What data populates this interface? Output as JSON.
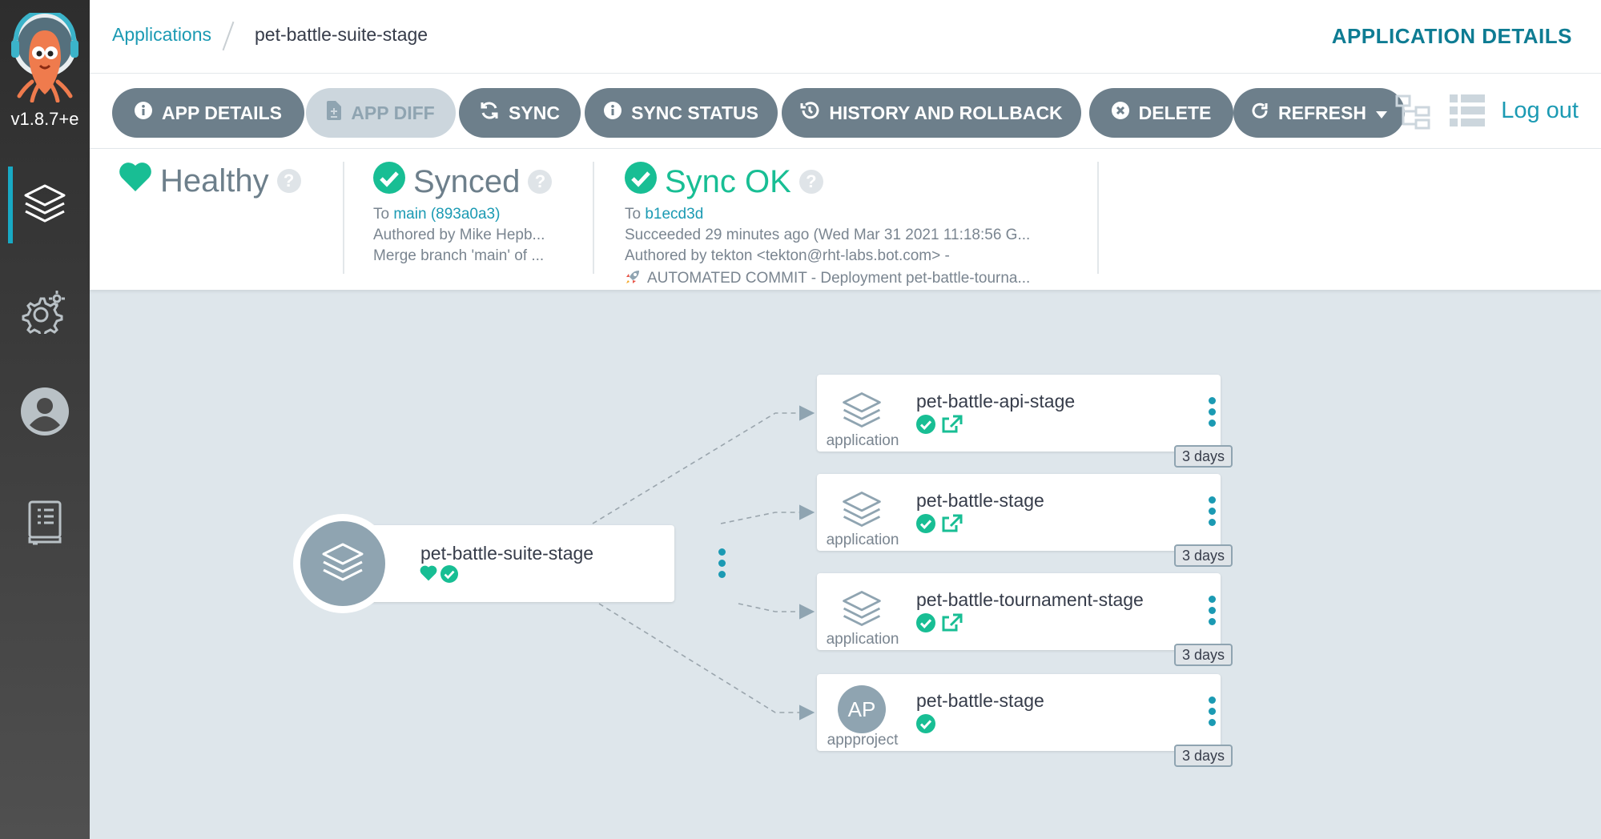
{
  "sidebar": {
    "version": "v1.8.7+e",
    "nav": [
      {
        "name": "applications",
        "icon": "layers-icon"
      },
      {
        "name": "settings",
        "icon": "gear-icon"
      },
      {
        "name": "user-info",
        "icon": "user-icon"
      },
      {
        "name": "docs",
        "icon": "book-icon"
      }
    ]
  },
  "breadcrumb": {
    "root": "Applications",
    "current": "pet-battle-suite-stage"
  },
  "page_heading": "APPLICATION DETAILS",
  "toolbar": {
    "app_details": "APP DETAILS",
    "app_diff": "APP DIFF",
    "sync": "SYNC",
    "sync_status": "SYNC STATUS",
    "history": "HISTORY AND ROLLBACK",
    "delete": "DELETE",
    "refresh": "REFRESH",
    "logout": "Log out"
  },
  "status": {
    "health": {
      "label": "Healthy",
      "color": "#18be94"
    },
    "sync": {
      "label": "Synced",
      "to_prefix": "To ",
      "to_ref": "main (893a0a3)",
      "author": "Authored by Mike Hepb...",
      "message": "Merge branch 'main' of ..."
    },
    "operation": {
      "label": "Sync OK",
      "to_prefix": "To ",
      "to_ref": "b1ecd3d",
      "succeeded": "Succeeded 29 minutes ago (Wed Mar 31 2021 11:18:56 G...",
      "author": "Authored by tekton <tekton@rht-labs.bot.com> -",
      "message": "AUTOMATED COMMIT - Deployment pet-battle-tourna..."
    }
  },
  "graph": {
    "root": {
      "name": "pet-battle-suite-stage"
    },
    "nodes": [
      {
        "name": "pet-battle-api-stage",
        "kind": "application",
        "age": "3 days"
      },
      {
        "name": "pet-battle-stage",
        "kind": "application",
        "age": "3 days"
      },
      {
        "name": "pet-battle-tournament-stage",
        "kind": "application",
        "age": "3 days"
      },
      {
        "name": "pet-battle-stage",
        "kind": "appproject",
        "avatar": "AP",
        "age": "3 days"
      }
    ]
  },
  "colors": {
    "accent": "#1b9ab3",
    "healthy": "#18be94",
    "button": "#6d7f8b",
    "sidebar": "#3c3c3c"
  }
}
